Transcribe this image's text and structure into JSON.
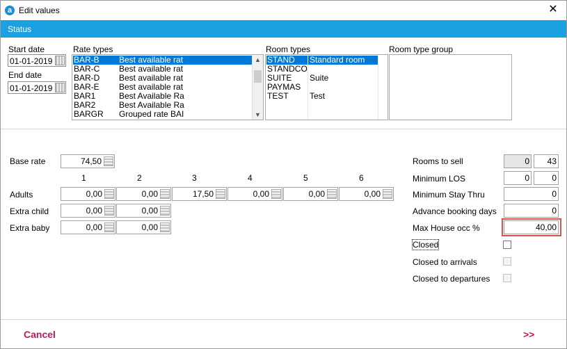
{
  "window": {
    "title": "Edit values",
    "app_icon_letter": "a",
    "close_glyph": "✕"
  },
  "status_bar": {
    "label": "Status"
  },
  "dates": {
    "start_label": "Start date",
    "start_value": "01-01-2019",
    "end_label": "End date",
    "end_value": "01-01-2019"
  },
  "rate_types": {
    "label": "Rate types",
    "items": [
      {
        "code": "BAR-B",
        "name": "Best available rat",
        "selected": true
      },
      {
        "code": "BAR-C",
        "name": "Best available rat"
      },
      {
        "code": "BAR-D",
        "name": "Best available rat"
      },
      {
        "code": "BAR-E",
        "name": "Best available rat"
      },
      {
        "code": "BAR1",
        "name": "Best Available Ra"
      },
      {
        "code": "BAR2",
        "name": "Best Available Ra"
      },
      {
        "code": "BARGR",
        "name": "Grouped rate BAI"
      }
    ]
  },
  "room_types": {
    "label": "Room types",
    "items": [
      {
        "code": "STAND",
        "name": "Standard room",
        "selected": true
      },
      {
        "code": "STANDCO",
        "name": ""
      },
      {
        "code": "SUITE",
        "name": "Suite"
      },
      {
        "code": "PAYMAS",
        "name": ""
      },
      {
        "code": "TEST",
        "name": "Test"
      }
    ]
  },
  "room_type_group": {
    "label": "Room type group"
  },
  "rates": {
    "base_rate_label": "Base rate",
    "base_rate_value": "74,50",
    "columns": [
      "1",
      "2",
      "3",
      "4",
      "5",
      "6"
    ],
    "adults_label": "Adults",
    "adults": [
      "0,00",
      "0,00",
      "17,50",
      "0,00",
      "0,00",
      "0,00"
    ],
    "extra_child_label": "Extra child",
    "extra_child": [
      "0,00",
      "0,00"
    ],
    "extra_baby_label": "Extra baby",
    "extra_baby": [
      "0,00",
      "0,00"
    ]
  },
  "right_panel": {
    "rooms_to_sell_label": "Rooms to sell",
    "rooms_to_sell_a": "0",
    "rooms_to_sell_b": "43",
    "min_los_label": "Minimum LOS",
    "min_los_a": "0",
    "min_los_b": "0",
    "min_stay_thru_label": "Minimum Stay Thru",
    "min_stay_thru": "0",
    "advance_booking_label": "Advance booking days",
    "advance_booking": "0",
    "max_house_label": "Max House occ %",
    "max_house": "40,00",
    "closed_label": "Closed",
    "closed_arrivals_label": "Closed to arrivals",
    "closed_departures_label": "Closed to departures"
  },
  "footer": {
    "cancel_label": "Cancel",
    "next_label": ">>"
  },
  "colors": {
    "status_bar": "#1ba1e2",
    "accent": "#c2185b",
    "highlight_box": "#d9534f",
    "selection": "#0078d7"
  }
}
